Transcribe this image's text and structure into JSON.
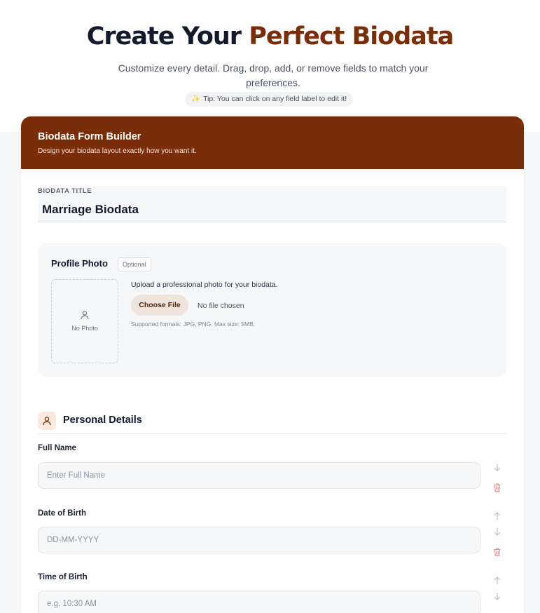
{
  "hero": {
    "title_part1": "Create Your ",
    "title_part2": "Perfect Biodata",
    "subtitle": "Customize every detail. Drag, drop, add, or remove fields to match your preferences.",
    "tip_text": "Tip: You can click on any field label to edit it!"
  },
  "builder": {
    "header_title": "Biodata Form Builder",
    "header_subtitle": "Design your biodata layout exactly how you want it.",
    "biodata_title_label": "BIODATA TITLE",
    "biodata_title_value": "Marriage Biodata"
  },
  "photo": {
    "title": "Profile Photo",
    "optional_badge": "Optional",
    "placeholder_text": "No Photo",
    "upload_description": "Upload a professional photo for your biodata.",
    "choose_button": "Choose File",
    "file_status": "No file chosen",
    "formats_note": "Supported formats: JPG, PNG. Max size: 5MB."
  },
  "section": {
    "title": "Personal Details",
    "fields": [
      {
        "label": "Full Name",
        "placeholder": "Enter Full Name",
        "value": ""
      },
      {
        "label": "Date of Birth",
        "placeholder": "DD-MM-YYYY",
        "value": ""
      },
      {
        "label": "Time of Birth",
        "placeholder": "e.g. 10:30 AM",
        "value": ""
      }
    ]
  },
  "colors": {
    "brand_primary": "#7a2d09",
    "delete_icon": "#e58a8a",
    "move_icon": "#b8bec8"
  }
}
